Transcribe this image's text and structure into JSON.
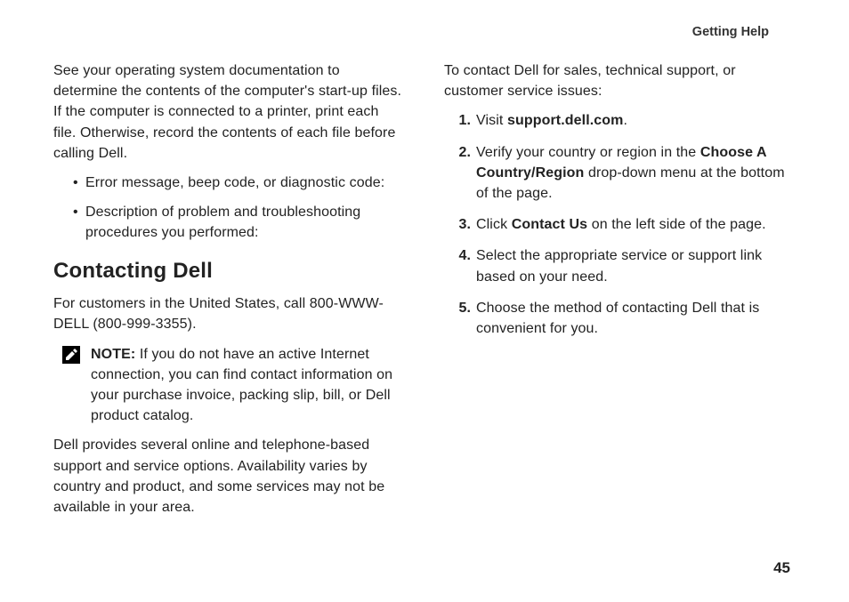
{
  "header": "Getting Help",
  "left": {
    "intro": "See your operating system documentation to determine the contents of the computer's start-up files. If the computer is connected to a printer, print each file. Otherwise, record the contents of each file before calling Dell.",
    "bullets": [
      "Error message, beep code, or diagnostic code:",
      "Description of problem and troubleshooting procedures you performed:"
    ],
    "heading": "Contacting Dell",
    "usCall": "For customers in the United States, call 800-WWW-DELL (800-999-3355).",
    "noteLabel": "NOTE:",
    "noteBody": " If you do not have an active Internet connection, you can find contact information on your purchase invoice, packing slip, bill, or Dell product catalog.",
    "support": "Dell provides several online and telephone-based support and service options. Availability varies by country and product, and some services may not be available in your area."
  },
  "right": {
    "intro": "To contact Dell for sales, technical support, or customer service issues:",
    "steps": [
      {
        "pre": "Visit ",
        "bold": "support.dell.com",
        "post": "."
      },
      {
        "pre": "Verify your country or region in the ",
        "bold": "Choose A Country/Region",
        "post": " drop-down menu at the bottom of the page."
      },
      {
        "pre": "Click ",
        "bold": "Contact Us",
        "post": " on the left side of the page."
      },
      {
        "pre": "Select the appropriate service or support link based on your need.",
        "bold": "",
        "post": ""
      },
      {
        "pre": "Choose the method of contacting Dell that is convenient for you.",
        "bold": "",
        "post": ""
      }
    ]
  },
  "pageNumber": "45"
}
